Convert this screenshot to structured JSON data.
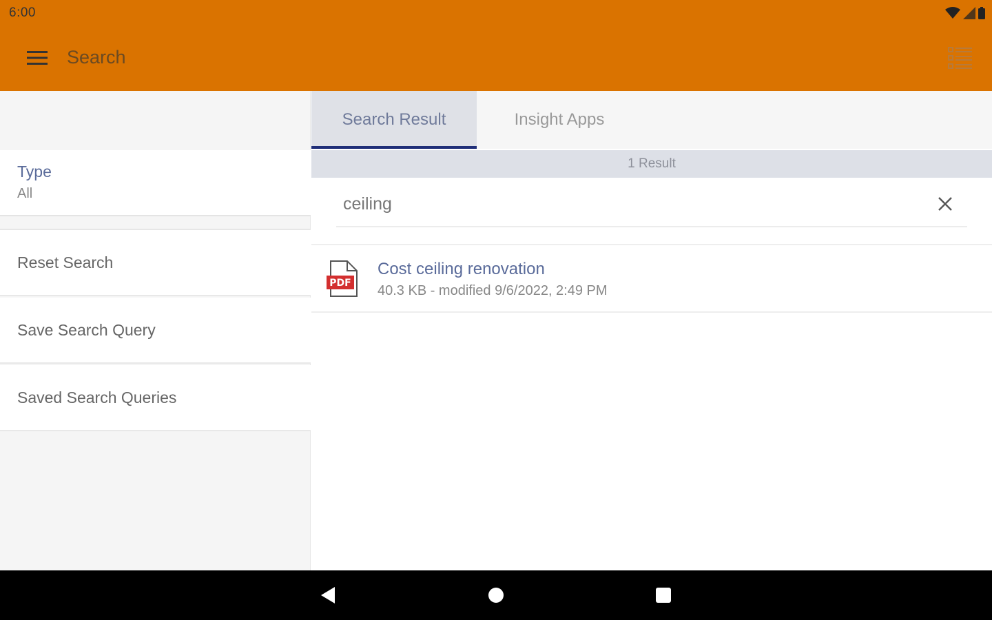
{
  "status_bar": {
    "time": "6:00",
    "icons": [
      "wifi-icon",
      "signal-icon",
      "battery-icon"
    ]
  },
  "toolbar": {
    "title": "Search",
    "menu_icon": "hamburger-menu-icon",
    "view_icon": "list-view-icon",
    "color": "#DA7300"
  },
  "filters": {
    "type_label": "Type",
    "type_value": "All"
  },
  "menu": {
    "items": [
      {
        "label": "Reset Search"
      },
      {
        "label": "Save Search Query"
      },
      {
        "label": "Saved Search Queries"
      }
    ]
  },
  "tabs": [
    {
      "label": "Search Result",
      "active": true
    },
    {
      "label": "Insight Apps",
      "active": false
    }
  ],
  "results": {
    "count_label": "1 Result",
    "query": "ceiling",
    "items": [
      {
        "icon": "pdf-file-icon",
        "title": "Cost ceiling renovation",
        "meta": "40.3 KB - modified 9/6/2022, 2:49 PM"
      }
    ]
  },
  "nav": {
    "buttons": [
      "back-icon",
      "home-icon",
      "recents-icon"
    ]
  },
  "colors": {
    "accent": "#DA7300",
    "tab_indicator": "#1f2e78",
    "link": "#5a6b9a"
  }
}
